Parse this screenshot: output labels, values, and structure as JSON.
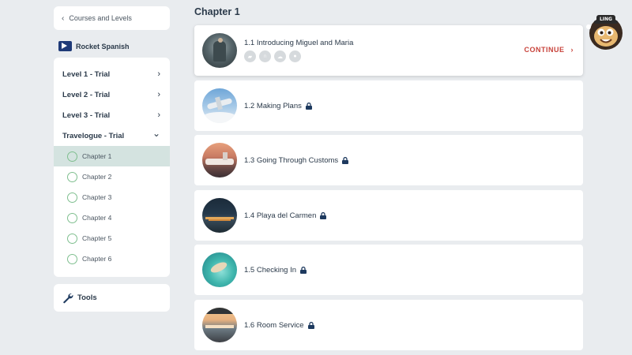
{
  "nav": {
    "back_label": "Courses and Levels"
  },
  "brand": {
    "name": "Rocket Spanish"
  },
  "levels": [
    {
      "label": "Level 1 - Trial",
      "arrow": "›"
    },
    {
      "label": "Level 2 - Trial",
      "arrow": "›"
    },
    {
      "label": "Level 3 - Trial",
      "arrow": "›"
    },
    {
      "label": "Travelogue - Trial",
      "arrow": "⌄"
    }
  ],
  "chapters": [
    {
      "label": "Chapter 1",
      "active": true
    },
    {
      "label": "Chapter 2"
    },
    {
      "label": "Chapter 3"
    },
    {
      "label": "Chapter 4"
    },
    {
      "label": "Chapter 5"
    },
    {
      "label": "Chapter 6"
    }
  ],
  "tools": {
    "label": "Tools"
  },
  "main": {
    "title": "Chapter 1",
    "continue_label": "CONTINUE",
    "lessons": [
      {
        "title": "1.1 Introducing Miguel and Maria",
        "locked": false
      },
      {
        "title": "1.2 Making Plans",
        "locked": true
      },
      {
        "title": "1.3 Going Through Customs",
        "locked": true
      },
      {
        "title": "1.4 Playa del Carmen",
        "locked": true
      },
      {
        "title": "1.5 Checking In",
        "locked": true
      },
      {
        "title": "1.6 Room Service",
        "locked": true
      }
    ]
  },
  "mascot": {
    "badge": "LING"
  },
  "colors": {
    "accent": "#c8433b",
    "active_bg": "#d4e3e0",
    "ring": "#7fbf8f",
    "brand_blue": "#1e3a78"
  }
}
